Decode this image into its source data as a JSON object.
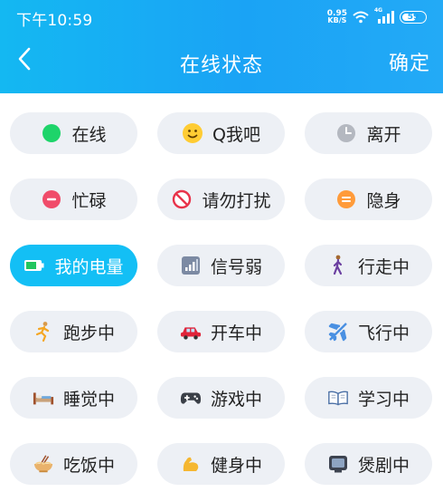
{
  "status_bar": {
    "time": "下午10:59",
    "net_speed_value": "0.95",
    "net_speed_unit": "KB/S",
    "signal_gen": "4G",
    "battery": "59"
  },
  "nav": {
    "title": "在线状态",
    "confirm_label": "确定"
  },
  "colors": {
    "header_start": "#14b8f2",
    "header_end": "#23aaf6",
    "active_chip": "#13bff5",
    "chip_bg": "#edf0f5"
  },
  "statuses": [
    {
      "label": "在线",
      "icon": "green-dot-icon",
      "active": false
    },
    {
      "label": "Q我吧",
      "icon": "smiley-icon",
      "active": false
    },
    {
      "label": "离开",
      "icon": "clock-icon",
      "active": false
    },
    {
      "label": "忙碌",
      "icon": "minus-circle-icon",
      "active": false
    },
    {
      "label": "请勿打扰",
      "icon": "no-entry-icon",
      "active": false
    },
    {
      "label": "隐身",
      "icon": "equals-circle-icon",
      "active": false
    },
    {
      "label": "我的电量",
      "icon": "battery-icon",
      "active": true
    },
    {
      "label": "信号弱",
      "icon": "signal-bars-icon",
      "active": false
    },
    {
      "label": "行走中",
      "icon": "walking-person-icon",
      "active": false
    },
    {
      "label": "跑步中",
      "icon": "running-person-icon",
      "active": false
    },
    {
      "label": "开车中",
      "icon": "car-icon",
      "active": false
    },
    {
      "label": "飞行中",
      "icon": "airplane-icon",
      "active": false
    },
    {
      "label": "睡觉中",
      "icon": "bed-icon",
      "active": false
    },
    {
      "label": "游戏中",
      "icon": "gamepad-icon",
      "active": false
    },
    {
      "label": "学习中",
      "icon": "open-book-icon",
      "active": false
    },
    {
      "label": "吃饭中",
      "icon": "noodle-bowl-icon",
      "active": false
    },
    {
      "label": "健身中",
      "icon": "flexed-bicep-icon",
      "active": false
    },
    {
      "label": "煲剧中",
      "icon": "television-icon",
      "active": false
    }
  ]
}
